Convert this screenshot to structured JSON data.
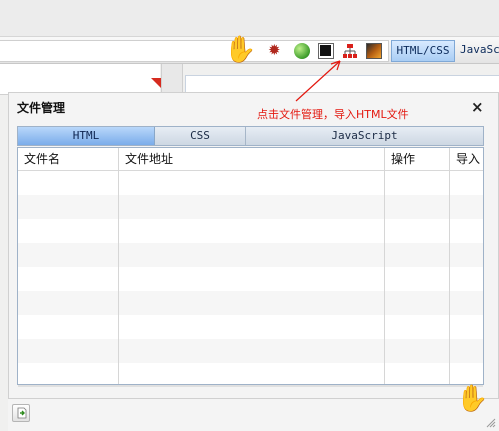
{
  "toolbar": {
    "tabs": [
      "HTML/CSS",
      "JavaSc"
    ],
    "icons": [
      "hand-pointer-icon",
      "bug-icon",
      "globe-icon",
      "window-icon",
      "sitemap-icon",
      "image-icon"
    ]
  },
  "annotation": {
    "text": "点击文件管理，导入HTML文件",
    "color": "#e3180f"
  },
  "dialog": {
    "title": "文件管理",
    "close_label": "×",
    "tabs": [
      {
        "label": "HTML",
        "active": true
      },
      {
        "label": "CSS",
        "active": false
      },
      {
        "label": "JavaScript",
        "active": false
      }
    ],
    "table": {
      "columns": [
        "文件名",
        "文件地址",
        "操作",
        "导入"
      ],
      "rows": []
    }
  },
  "colors": {
    "accent": "#7aacea",
    "annotation": "#e3180f",
    "hand": "#f08a1e"
  }
}
